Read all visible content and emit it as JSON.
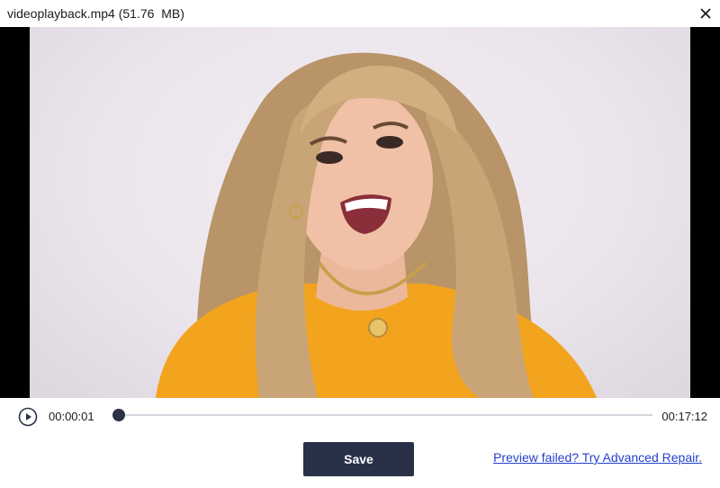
{
  "window": {
    "title": "videoplayback.mp4 (51.76  MB)",
    "close_icon": "close-icon"
  },
  "player": {
    "current_time": "00:00:01",
    "total_time": "00:17:12",
    "progress": 0.001,
    "play_icon": "play-circle-icon"
  },
  "actions": {
    "save_label": "Save",
    "advanced_repair_link": "Preview failed? Try Advanced Repair."
  },
  "colors": {
    "primary_button": "#283148",
    "link": "#2440d0",
    "seek_track": "#d3d6dc",
    "seek_fill": "#2b3246"
  }
}
